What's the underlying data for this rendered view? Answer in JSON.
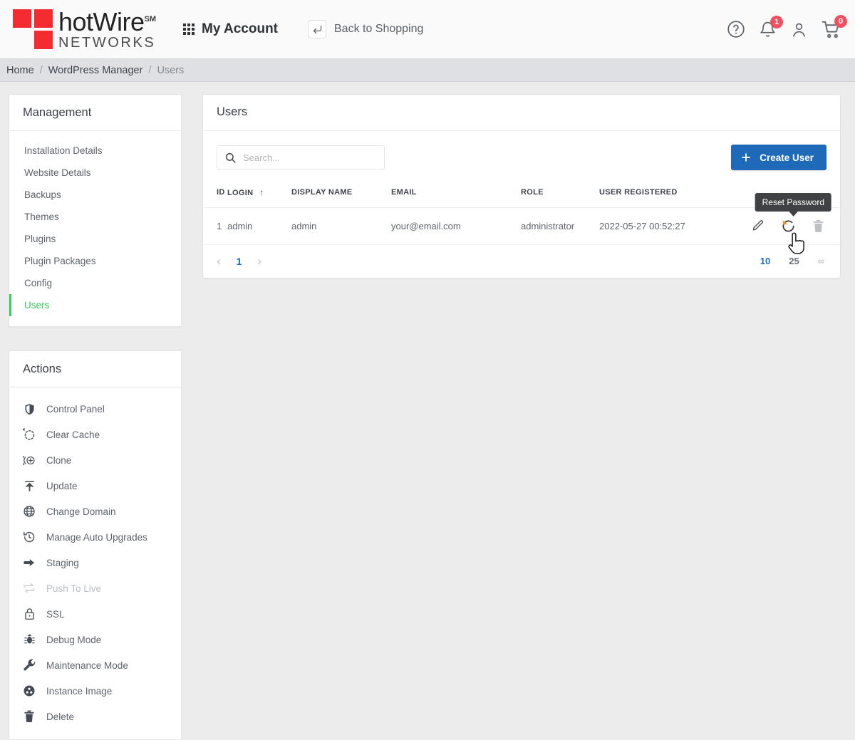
{
  "header": {
    "logo": {
      "brand_top": "hotWire",
      "trademark": "SM",
      "brand_bottom": "NETWORKS",
      "color": "#f42b30"
    },
    "my_account": "My Account",
    "back_to_shopping": "Back to Shopping",
    "icons": {
      "help": "help-circle-icon",
      "notifications": "bell-icon",
      "notifications_count": "1",
      "account": "user-icon",
      "cart": "cart-icon",
      "cart_count": "0"
    },
    "badge_color": "#ef5160"
  },
  "breadcrumb": {
    "items": [
      {
        "label": "Home",
        "current": false
      },
      {
        "label": "WordPress Manager",
        "current": false
      },
      {
        "label": "Users",
        "current": true
      }
    ],
    "separator": "/"
  },
  "sidebar": {
    "management": {
      "title": "Management",
      "items": [
        {
          "label": "Installation Details",
          "active": false
        },
        {
          "label": "Website Details",
          "active": false
        },
        {
          "label": "Backups",
          "active": false
        },
        {
          "label": "Themes",
          "active": false
        },
        {
          "label": "Plugins",
          "active": false
        },
        {
          "label": "Plugin Packages",
          "active": false
        },
        {
          "label": "Config",
          "active": false
        },
        {
          "label": "Users",
          "active": true
        }
      ],
      "active_color": "#3ccb5a"
    },
    "actions": {
      "title": "Actions",
      "items": [
        {
          "label": "Control Panel",
          "icon": "shield-icon",
          "disabled": false
        },
        {
          "label": "Clear Cache",
          "icon": "refresh-dashed-icon",
          "disabled": false
        },
        {
          "label": "Clone",
          "icon": "clone-plus-icon",
          "disabled": false
        },
        {
          "label": "Update",
          "icon": "upload-update-icon",
          "disabled": false
        },
        {
          "label": "Change Domain",
          "icon": "globe-icon",
          "disabled": false
        },
        {
          "label": "Manage Auto Upgrades",
          "icon": "clock-history-icon",
          "disabled": false
        },
        {
          "label": "Staging",
          "icon": "arrow-right-icon",
          "disabled": false
        },
        {
          "label": "Push To Live",
          "icon": "sync-arrows-icon",
          "disabled": true
        },
        {
          "label": "SSL",
          "icon": "lock-icon",
          "disabled": false
        },
        {
          "label": "Debug Mode",
          "icon": "bug-icon",
          "disabled": false
        },
        {
          "label": "Maintenance Mode",
          "icon": "wrench-icon",
          "disabled": false
        },
        {
          "label": "Instance Image",
          "icon": "instance-image-icon",
          "disabled": false
        },
        {
          "label": "Delete",
          "icon": "trash-icon",
          "disabled": false
        }
      ]
    }
  },
  "main": {
    "title": "Users",
    "search": {
      "value": "",
      "placeholder": "Search...",
      "icon": "search-icon"
    },
    "create_button": {
      "label": "Create User",
      "icon": "plus-icon",
      "color": "#1e69b8"
    },
    "table": {
      "columns": [
        "ID",
        "LOGIN",
        "DISPLAY NAME",
        "EMAIL",
        "ROLE",
        "USER REGISTERED"
      ],
      "sorted_column": "LOGIN",
      "sort_direction": "↑",
      "rows": [
        {
          "id": "1",
          "login": "admin",
          "display_name": "admin",
          "email": "your@email.com",
          "role": "administrator",
          "user_registered": "2022-05-27 00:52:27",
          "actions": [
            "edit-icon",
            "reset-password-icon",
            "delete-icon"
          ]
        }
      ]
    },
    "tooltip": {
      "text": "Reset Password",
      "visible": true
    },
    "pagination": {
      "prev": "‹",
      "next": "›",
      "pages": [
        "1"
      ],
      "current_page": "1",
      "page_sizes": [
        {
          "label": "10",
          "active": true
        },
        {
          "label": "25",
          "active": false
        },
        {
          "label": "∞",
          "active": false
        }
      ]
    }
  }
}
